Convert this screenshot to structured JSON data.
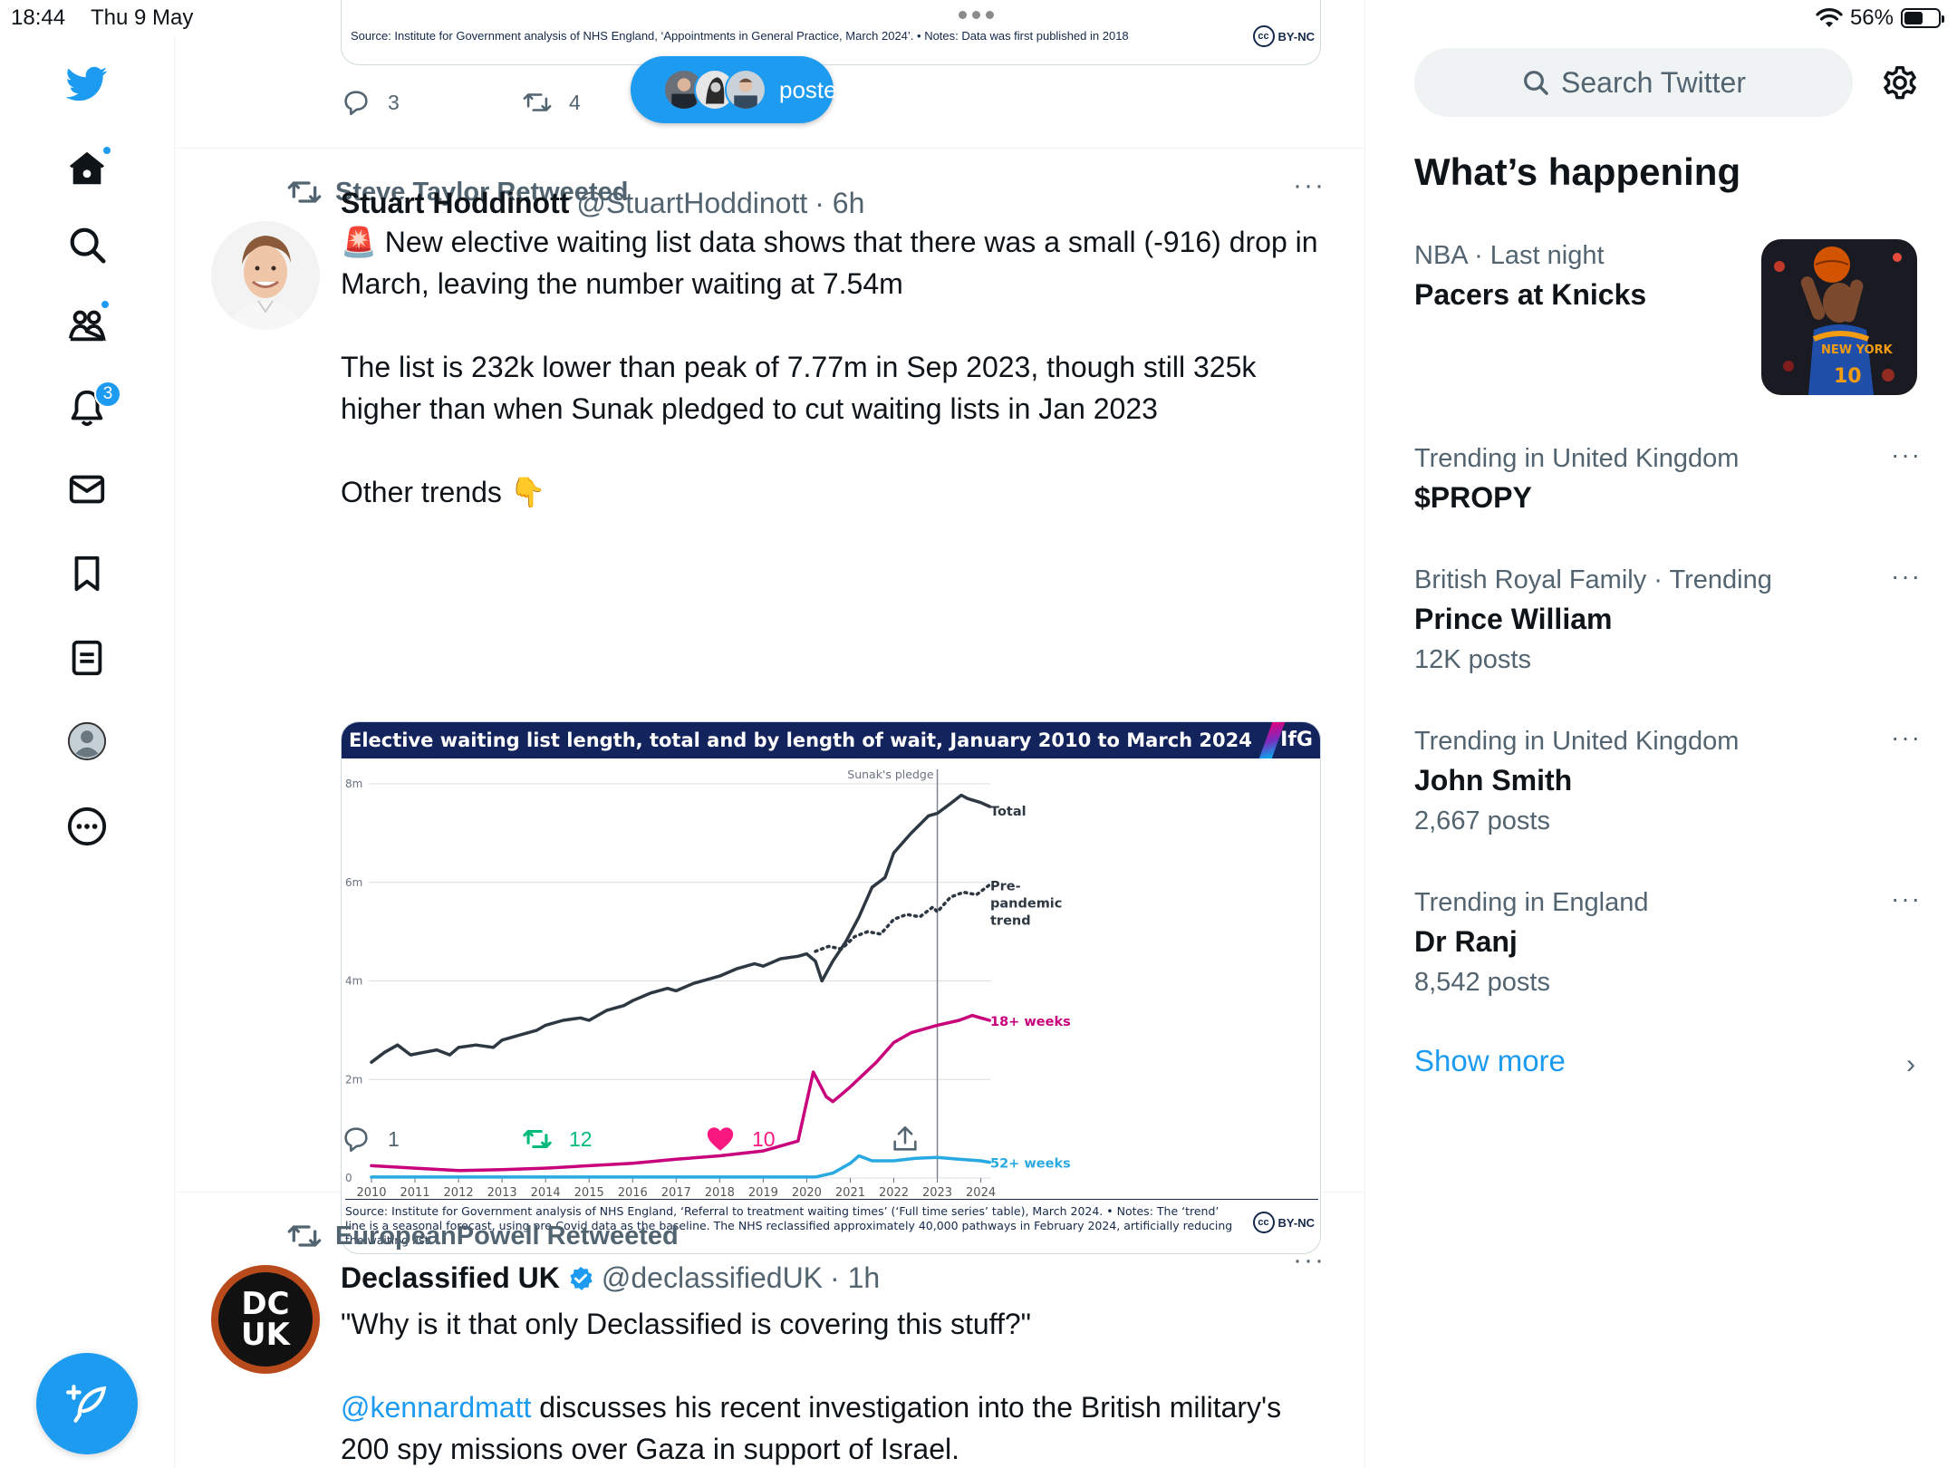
{
  "status_bar": {
    "time": "18:44",
    "date": "Thu 9 May",
    "battery": "56%",
    "battery_level": 0.56
  },
  "colors": {
    "accent": "#1d9bf0",
    "text": "#0f1419",
    "muted": "#536471",
    "like": "#f91880",
    "retweet": "#00ba7c",
    "ifg_navy": "#13235b",
    "total_series": "#2d3842",
    "weeks18_series": "#c8007c",
    "weeks52_series": "#29a9e1"
  },
  "nav": {
    "icons": [
      "twitter-logo-icon",
      "home-icon",
      "search-icon",
      "communities-icon",
      "notifications-icon",
      "messages-icon",
      "bookmarks-icon",
      "lists-icon",
      "profile-icon",
      "more-icon",
      "compose-icon"
    ],
    "notifications_badge": "3"
  },
  "posted_pill": {
    "label": "posted"
  },
  "top_tweet": {
    "source": "Source: Institute for Government analysis of NHS England, ‘Appointments in General Practice, March 2024’. • Notes: Data was first published in 2018",
    "license": "BY-NC",
    "cc": "cc",
    "replies": "3",
    "retweets": "4"
  },
  "tweet1": {
    "retweeted_by": "Steve Taylor Retweeted",
    "name": "Stuart Hoddinott",
    "handle": "@StuartHoddinott",
    "time": "· 6h",
    "paragraphs": [
      "🚨 New elective waiting list data shows that there was a small (-916) drop in March, leaving the number waiting at 7.54m",
      "The list is 232k lower than peak of 7.77m in Sep 2023, though still 325k higher than when Sunak pledged to cut waiting lists in Jan 2023",
      "Other trends 👇"
    ],
    "replies": "1",
    "retweets": "12",
    "likes": "10",
    "more": "···"
  },
  "chart_card": {
    "header": "Elective waiting list length, total and by length of wait, January 2010 to March 2024",
    "brand": "IfG",
    "source": "Source: Institute for Government analysis of NHS England, ‘Referral to treatment waiting times’ (‘Full time series’ table), March 2024. • Notes: The ‘trend’ line is a seasonal forecast, using pre-Covid data as the baseline. The NHS reclassified approximately 40,000 pathways in February 2024, artificially reducing the waiting list.",
    "license": "BY-NC",
    "cc": "cc"
  },
  "chart_data": {
    "type": "line",
    "title": "Elective waiting list length, total and by length of wait, January 2010 to March 2024",
    "y_ticks": [
      "0",
      "2m",
      "4m",
      "6m",
      "8m"
    ],
    "ylim": [
      0,
      8
    ],
    "x_ticks": [
      "2010",
      "2011",
      "2012",
      "2013",
      "2014",
      "2015",
      "2016",
      "2017",
      "2018",
      "2019",
      "2020",
      "2021",
      "2022",
      "2023",
      "2024"
    ],
    "xlim": [
      2010,
      2024.3
    ],
    "annotation": {
      "label": "Sunak's pledge",
      "x": 2023.0
    },
    "series": [
      {
        "name": "Total",
        "style": "solid",
        "x": [
          2010.0,
          2010.3,
          2010.6,
          2010.9,
          2011.2,
          2011.5,
          2011.8,
          2012.0,
          2012.4,
          2012.8,
          2013.0,
          2013.4,
          2013.8,
          2014.0,
          2014.4,
          2014.8,
          2015.0,
          2015.4,
          2015.8,
          2016.0,
          2016.4,
          2016.8,
          2017.0,
          2017.4,
          2017.8,
          2018.0,
          2018.4,
          2018.8,
          2019.0,
          2019.4,
          2019.8,
          2020.0,
          2020.2,
          2020.35,
          2020.6,
          2020.9,
          2021.2,
          2021.5,
          2021.8,
          2022.0,
          2022.4,
          2022.8,
          2023.0,
          2023.3,
          2023.55,
          2023.7,
          2024.0,
          2024.2
        ],
        "values": [
          2.35,
          2.55,
          2.7,
          2.5,
          2.55,
          2.6,
          2.5,
          2.65,
          2.7,
          2.65,
          2.8,
          2.9,
          3.0,
          3.1,
          3.2,
          3.25,
          3.2,
          3.4,
          3.5,
          3.6,
          3.75,
          3.85,
          3.8,
          3.95,
          4.05,
          4.1,
          4.25,
          4.35,
          4.3,
          4.45,
          4.5,
          4.55,
          4.4,
          4.0,
          4.4,
          4.8,
          5.3,
          5.9,
          6.1,
          6.6,
          7.0,
          7.35,
          7.4,
          7.6,
          7.77,
          7.7,
          7.62,
          7.54
        ]
      },
      {
        "name": "Pre-pandemic trend",
        "style": "dotted",
        "x": [
          2020.2,
          2020.5,
          2020.8,
          2021.1,
          2021.4,
          2021.7,
          2022.0,
          2022.3,
          2022.6,
          2022.9,
          2023.0,
          2023.3,
          2023.6,
          2023.9,
          2024.2
        ],
        "values": [
          4.6,
          4.7,
          4.65,
          4.9,
          5.0,
          4.95,
          5.25,
          5.35,
          5.3,
          5.5,
          5.4,
          5.7,
          5.8,
          5.75,
          5.95
        ]
      },
      {
        "name": "18+ weeks",
        "style": "solid",
        "x": [
          2010.0,
          2011.0,
          2012.0,
          2013.0,
          2014.0,
          2015.0,
          2016.0,
          2017.0,
          2018.0,
          2019.0,
          2019.8,
          2020.15,
          2020.45,
          2020.6,
          2020.8,
          2021.0,
          2021.3,
          2021.6,
          2022.0,
          2022.4,
          2022.8,
          2023.0,
          2023.5,
          2023.8,
          2024.0,
          2024.2
        ],
        "values": [
          0.25,
          0.2,
          0.15,
          0.17,
          0.2,
          0.25,
          0.3,
          0.38,
          0.45,
          0.55,
          0.75,
          2.15,
          1.65,
          1.55,
          1.7,
          1.85,
          2.1,
          2.35,
          2.75,
          2.95,
          3.05,
          3.1,
          3.2,
          3.3,
          3.25,
          3.2
        ]
      },
      {
        "name": "52+ weeks",
        "style": "solid",
        "x": [
          2010.0,
          2015.0,
          2019.5,
          2020.2,
          2020.6,
          2021.0,
          2021.2,
          2021.5,
          2022.0,
          2022.5,
          2023.0,
          2023.5,
          2024.0,
          2024.2
        ],
        "values": [
          0.02,
          0.02,
          0.02,
          0.02,
          0.1,
          0.3,
          0.45,
          0.35,
          0.35,
          0.4,
          0.42,
          0.38,
          0.35,
          0.32
        ]
      }
    ],
    "end_labels": [
      {
        "series": "Total",
        "label": "Total"
      },
      {
        "series": "Pre-pandemic trend",
        "label_lines": [
          "Pre-",
          "pandemic",
          "trend"
        ]
      },
      {
        "series": "18+ weeks",
        "label": "18+ weeks"
      },
      {
        "series": "52+ weeks",
        "label": "52+ weeks"
      }
    ],
    "grid": true,
    "legend": "direct labels at line ends"
  },
  "tweet2": {
    "retweeted_by": "EuropeanPowell Retweeted",
    "name": "Declassified UK",
    "handle": "@declassifiedUK",
    "time": "· 1h",
    "avatar_text_1": "DC",
    "avatar_text_2": "UK",
    "line1": "\"Why is it that only Declassified is covering this stuff?\"",
    "mention": "@kennardmatt",
    "line2_rest": " discusses his recent investigation into the British military's 200 spy missions over Gaza in support of Israel.",
    "more": "···"
  },
  "sidebar": {
    "search_placeholder": "Search Twitter",
    "section_title": "What’s happening",
    "trends": [
      {
        "meta": "NBA · Last night",
        "name": "Pacers at Knicks",
        "count": ""
      },
      {
        "meta": "Trending in United Kingdom",
        "name": "$PROPY",
        "count": ""
      },
      {
        "meta": "British Royal Family · Trending",
        "name": "Prince William",
        "count": "12K posts"
      },
      {
        "meta": "Trending in United Kingdom",
        "name": "John Smith",
        "count": "2,667 posts"
      },
      {
        "meta": "Trending in England",
        "name": "Dr Ranj",
        "count": "8,542 posts"
      }
    ],
    "more_label": "···",
    "show_more": "Show more"
  }
}
